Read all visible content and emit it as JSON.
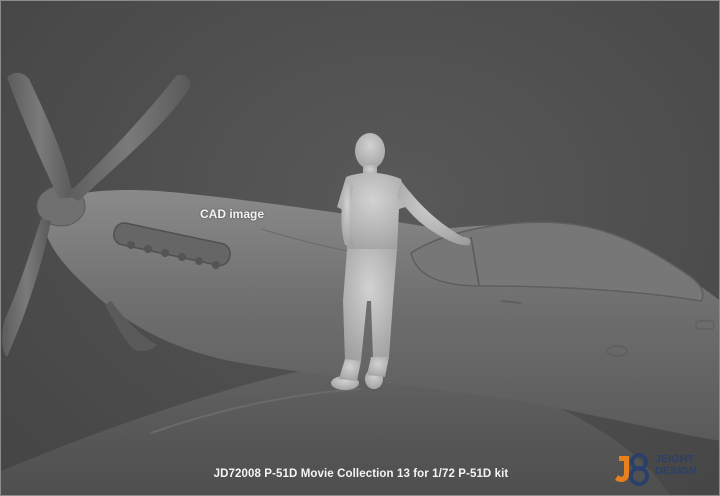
{
  "scene": {
    "subject": "CAD render of a standing figure leaning on a P-51D aircraft",
    "background_color": "#4a4a4a"
  },
  "labels": {
    "cad_image": "CAD image",
    "caption": "JD72008 P-51D Movie Collection 13 for 1/72 P-51D kit"
  },
  "logo": {
    "mark": "J8",
    "line1": "JEIGHT",
    "line2": "DESIGN",
    "orange": "#e8801e",
    "blue": "#2a3f6a"
  }
}
